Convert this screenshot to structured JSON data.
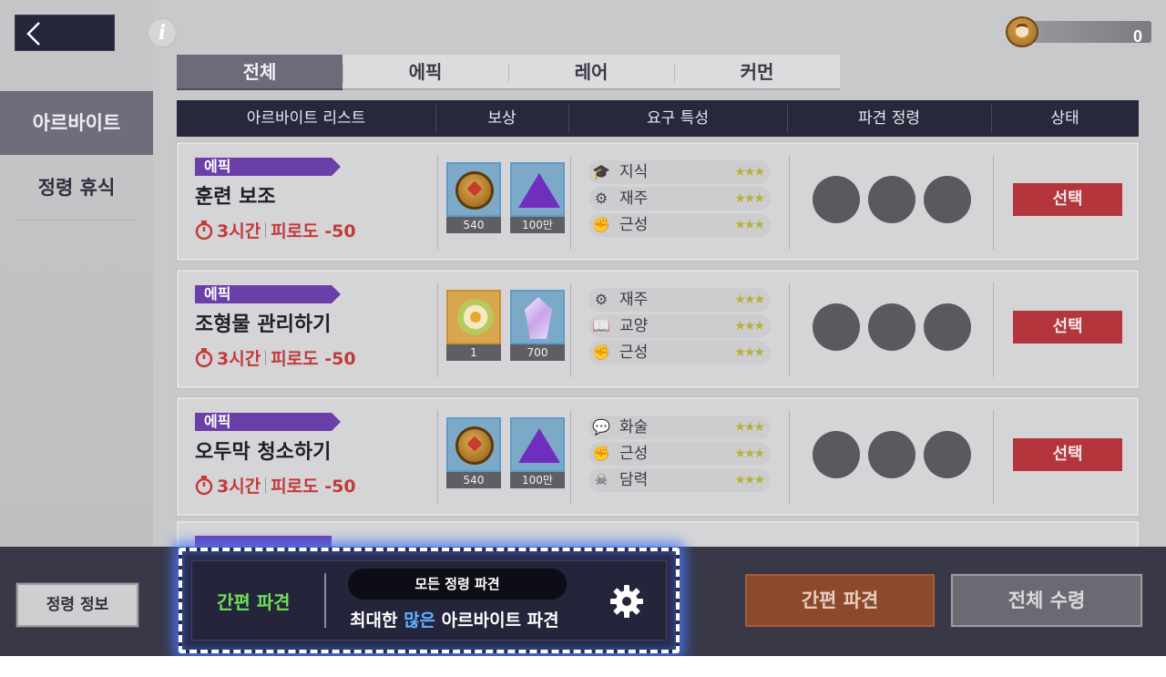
{
  "header": {
    "back_icon": "chevron-left-icon",
    "info_icon_glyph": "i",
    "currency_value": "0"
  },
  "sidebar": {
    "items": [
      {
        "label": "아르바이트",
        "active": true
      },
      {
        "label": "정령 휴식",
        "active": false
      }
    ]
  },
  "tabs": [
    {
      "label": "전체",
      "active": true
    },
    {
      "label": "에픽",
      "active": false
    },
    {
      "label": "레어",
      "active": false
    },
    {
      "label": "커먼",
      "active": false
    }
  ],
  "table": {
    "headers": [
      "아르바이트 리스트",
      "보상",
      "요구 특성",
      "파견 정령",
      "상태"
    ],
    "rows": [
      {
        "rarity": "에픽",
        "name": "훈련 보조",
        "time": "3시간",
        "fatigue": "피로도 -50",
        "rewards": [
          {
            "type": "gold-coin",
            "qty": "540"
          },
          {
            "type": "purple-gem",
            "qty": "100만"
          }
        ],
        "traits": [
          {
            "icon": "graduation-cap-icon",
            "name": "지식",
            "stars": "★★★"
          },
          {
            "icon": "skill-gear-icon",
            "name": "재주",
            "stars": "★★★"
          },
          {
            "icon": "fist-icon",
            "name": "근성",
            "stars": "★★★"
          }
        ],
        "status": "선택"
      },
      {
        "rarity": "에픽",
        "name": "조형물 관리하기",
        "time": "3시간",
        "fatigue": "피로도 -50",
        "rewards": [
          {
            "type": "flower-bouquet",
            "qty": "1"
          },
          {
            "type": "crystal",
            "qty": "700"
          }
        ],
        "traits": [
          {
            "icon": "skill-gear-icon",
            "name": "재주",
            "stars": "★★★"
          },
          {
            "icon": "book-icon",
            "name": "교양",
            "stars": "★★★"
          },
          {
            "icon": "fist-icon",
            "name": "근성",
            "stars": "★★★"
          }
        ],
        "status": "선택"
      },
      {
        "rarity": "에픽",
        "name": "오두막 청소하기",
        "time": "3시간",
        "fatigue": "피로도 -50",
        "rewards": [
          {
            "type": "gold-coin",
            "qty": "540"
          },
          {
            "type": "purple-gem",
            "qty": "100만"
          }
        ],
        "traits": [
          {
            "icon": "speech-icon",
            "name": "화술",
            "stars": "★★★"
          },
          {
            "icon": "fist-icon",
            "name": "근성",
            "stars": "★★★"
          },
          {
            "icon": "courage-icon",
            "name": "담력",
            "stars": "★★★"
          }
        ],
        "status": "선택"
      }
    ]
  },
  "bottom": {
    "spirit_info": "정령 정보",
    "quick_label": "간편 파견",
    "mode_pill": "모든 정령 파견",
    "mode_desc_prefix": "최대한 ",
    "mode_desc_highlight": "많은",
    "mode_desc_suffix": " 아르바이트 파견",
    "quick_dispatch": "간편 파견",
    "collect_all": "전체 수령"
  },
  "colors": {
    "accent_epic": "#6b3fa8",
    "select_button": "#b5353d",
    "quick_label": "#6fe055",
    "highlight": "#5fb2ff",
    "dispatch_button": "#8c4a2c"
  }
}
